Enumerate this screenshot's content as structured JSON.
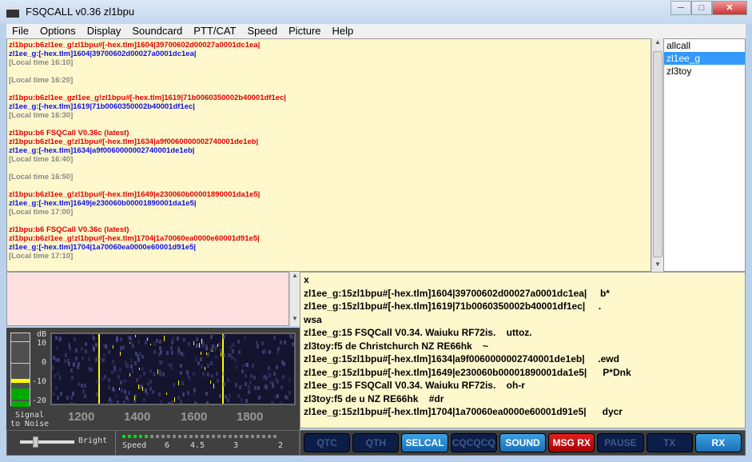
{
  "window": {
    "title": "FSQCALL v0.36  zl1bpu",
    "minimize": "─",
    "maximize": "□",
    "close": "✕"
  },
  "menu": [
    "File",
    "Options",
    "Display",
    "Soundcard",
    "PTT/CAT",
    "Speed",
    "Picture",
    "Help"
  ],
  "rx_log": [
    {
      "c": "red",
      "t": "zl1bpu:b6zl1ee_g!zl1bpu#[-hex.tlm]1604|39700602d00027a0001dc1ea|"
    },
    {
      "c": "blue",
      "t": "zl1ee_g:[-hex.tlm]1604|39700602d00027a0001dc1ea|"
    },
    {
      "c": "gray",
      "t": "[Local time 16:10]"
    },
    {
      "c": "gap",
      "t": ""
    },
    {
      "c": "gray",
      "t": "[Local time 16:20]"
    },
    {
      "c": "gap",
      "t": ""
    },
    {
      "c": "red",
      "t": "zl1bpu:b6zl1ee_gzl1ee_g!zl1bpu#[-hex.tlm]1619|71b0060350002b40001df1ec|"
    },
    {
      "c": "blue",
      "t": "zl1ee_g:[-hex.tlm]1619|71b0060350002b40001df1ec|"
    },
    {
      "c": "gray",
      "t": "[Local time 16:30]"
    },
    {
      "c": "gap",
      "t": ""
    },
    {
      "c": "red",
      "t": "zl1bpu:b6 FSQCall V0.36c (latest)"
    },
    {
      "c": "red",
      "t": "zl1bpu:b6zl1ee_g!zl1bpu#[-hex.tlm]1634|a9f0060000002740001de1eb|"
    },
    {
      "c": "blue",
      "t": "zl1ee_g:[-hex.tlm]1634|a9f0060000002740001de1eb|"
    },
    {
      "c": "gray",
      "t": "[Local time 16:40]"
    },
    {
      "c": "gap",
      "t": ""
    },
    {
      "c": "gray",
      "t": "[Local time 16:50]"
    },
    {
      "c": "gap",
      "t": ""
    },
    {
      "c": "red",
      "t": "zl1bpu:b6zl1ee_g!zl1bpu#[-hex.tlm]1649|e230060b00001890001da1e5|"
    },
    {
      "c": "blue",
      "t": "zl1ee_g:[-hex.tlm]1649|e230060b00001890001da1e5|"
    },
    {
      "c": "gray",
      "t": "[Local time 17:00]"
    },
    {
      "c": "gap",
      "t": ""
    },
    {
      "c": "red",
      "t": "zl1bpu:b6 FSQCall V0.36c (latest)"
    },
    {
      "c": "red",
      "t": "zl1bpu:b6zl1ee_g!zl1bpu#[-hex.tlm]1704|1a70060ea0000e60001d91e5|"
    },
    {
      "c": "blue",
      "t": "zl1ee_g:[-hex.tlm]1704|1a70060ea0000e60001d91e5|"
    },
    {
      "c": "gray",
      "t": "[Local time 17:10]"
    }
  ],
  "users": [
    "allcall",
    "zl1ee_g",
    "zl3toy"
  ],
  "selected_user": "zl1ee_g",
  "decoder_output": [
    "x",
    "zl1ee_g:15zl1bpu#[-hex.tlm]1604|39700602d00027a0001dc1ea|     b*",
    "zl1ee_g:15zl1bpu#[-hex.tlm]1619|71b0060350002b40001df1ec|     .",
    "wsa",
    "zl1ee_g:15 FSQCall V0.34. Waiuku RF72is.    uttoz.",
    "zl3toy:f5 de Christchurch NZ RE66hk    ~",
    "zl1ee_g:15zl1bpu#[-hex.tlm]1634|a9f0060000002740001de1eb|     .ewd",
    "zl1ee_g:15zl1bpu#[-hex.tlm]1649|e230060b00001890001da1e5|      P*Dnk",
    "zl1ee_g:15 FSQCall V0.34. Waiuku RF72is.    oh-r",
    "zl3toy:f5 de u NZ RE66hk    #dr",
    "zl1ee_g:15zl1bpu#[-hex.tlm]1704|1a70060ea0000e60001d91e5|      dycr"
  ],
  "meter": {
    "unit": "dB",
    "ticks": [
      "10",
      "0",
      "-10",
      "-20"
    ],
    "label1": "Signal",
    "label2": "to Noise",
    "level_db": -9
  },
  "waterfall": {
    "freq_labels": [
      "1200",
      "1400",
      "1600",
      "1800"
    ],
    "cursor_low_hz": 1265,
    "cursor_high_hz": 1708
  },
  "controls": {
    "bright_label": "Bright",
    "bright_value": 0.4,
    "speed_label": "Speed",
    "speed_values": [
      "6",
      "4.5",
      "3",
      "2"
    ],
    "speed_leds_on": 5,
    "speed_leds_total": 28
  },
  "buttons": [
    {
      "label": "QTC",
      "state": "off"
    },
    {
      "label": "QTH",
      "state": "off"
    },
    {
      "label": "SELCAL",
      "state": "on"
    },
    {
      "label": "CQCQCQ",
      "state": "off"
    },
    {
      "label": "SOUND",
      "state": "on"
    },
    {
      "label": "MSG RX",
      "state": "red"
    },
    {
      "label": "PAUSE",
      "state": "off"
    },
    {
      "label": "TX",
      "state": "off"
    },
    {
      "label": "RX",
      "state": "on"
    }
  ]
}
